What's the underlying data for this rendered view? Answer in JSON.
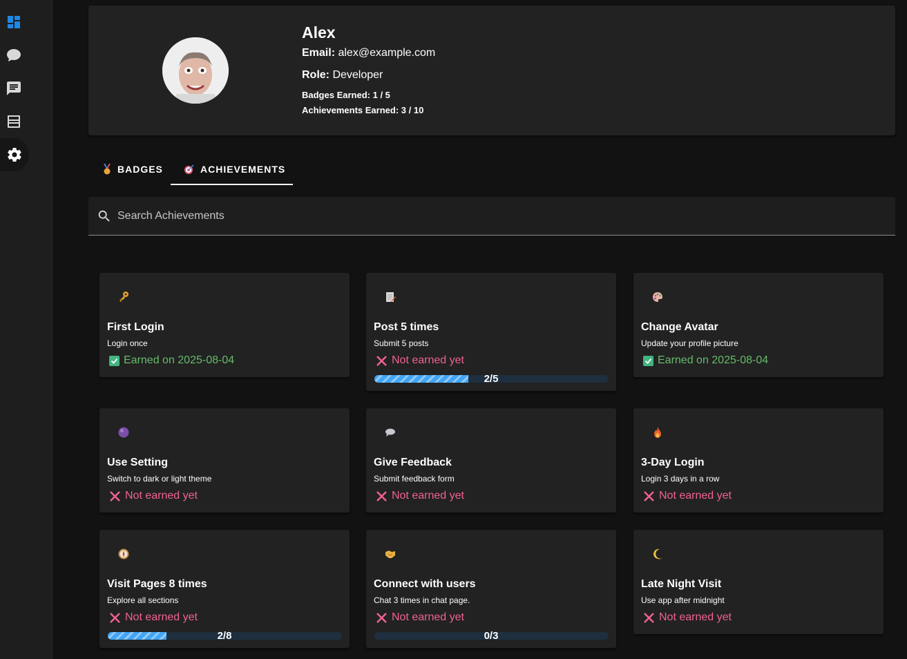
{
  "profile": {
    "name": "Alex",
    "email_label": "Email:",
    "email": "alex@example.com",
    "role_label": "Role:",
    "role": "Developer",
    "badges_label": "Badges Earned:",
    "badges_value": "1 / 5",
    "achievements_label": "Achievements Earned:",
    "achievements_value": "3 / 10"
  },
  "tabs": [
    {
      "label": "BADGES",
      "icon": "medal-icon"
    },
    {
      "label": "ACHIEVEMENTS",
      "icon": "target-icon",
      "active": true
    }
  ],
  "search": {
    "placeholder": "Search Achievements",
    "value": ""
  },
  "achievements": [
    {
      "icon": "key-icon",
      "title": "First Login",
      "desc": "Login once",
      "status": "Earned on 2025-08-04",
      "earned": true
    },
    {
      "icon": "memo-icon",
      "title": "Post 5 times",
      "desc": "Submit 5 posts",
      "status": "Not earned yet",
      "earned": false,
      "progress": "2/5",
      "progress_fraction": 0.4
    },
    {
      "icon": "palette-icon",
      "title": "Change Avatar",
      "desc": "Update your profile picture",
      "status": "Earned on 2025-08-04",
      "earned": true
    },
    {
      "icon": "purple-circle-icon",
      "title": "Use Setting",
      "desc": "Switch to dark or light theme",
      "status": "Not earned yet",
      "earned": false
    },
    {
      "icon": "speech-bubble-icon",
      "title": "Give Feedback",
      "desc": "Submit feedback form",
      "status": "Not earned yet",
      "earned": false
    },
    {
      "icon": "fire-icon",
      "title": "3-Day Login",
      "desc": "Login 3 days in a row",
      "status": "Not earned yet",
      "earned": false
    },
    {
      "icon": "compass-icon",
      "title": "Visit Pages 8 times",
      "desc": "Explore all sections",
      "status": "Not earned yet",
      "earned": false,
      "progress": "2/8",
      "progress_fraction": 0.25
    },
    {
      "icon": "handshake-icon",
      "title": "Connect with users",
      "desc": "Chat 3 times in chat page.",
      "status": "Not earned yet",
      "earned": false,
      "progress": "0/3",
      "progress_fraction": 0
    },
    {
      "icon": "crescent-moon-icon",
      "title": "Late Night Visit",
      "desc": "Use app after midnight",
      "status": "Not earned yet",
      "earned": false
    }
  ],
  "colors": {
    "earned": "#66bb6a",
    "not_earned": "#f06292",
    "progress": "#42a5f5",
    "dashboard_icon": "#1e88e5"
  }
}
